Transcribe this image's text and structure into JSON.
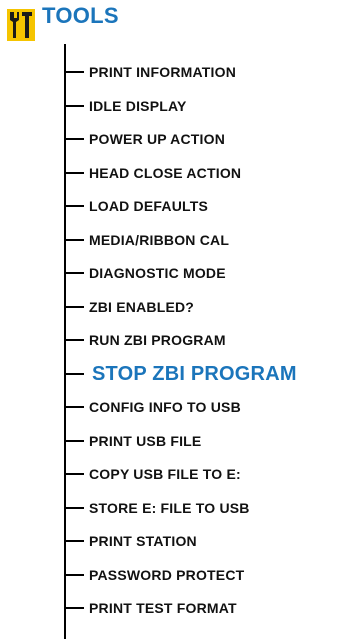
{
  "header": {
    "title": "TOOLS",
    "icon": "tools-icon",
    "colors": {
      "title": "#1b75bb",
      "icon_bg": "#f5c400",
      "icon_fg": "#1a1a1a"
    }
  },
  "menu": {
    "items": [
      {
        "label": "PRINT INFORMATION"
      },
      {
        "label": "IDLE DISPLAY"
      },
      {
        "label": "POWER UP ACTION"
      },
      {
        "label": "HEAD CLOSE ACTION"
      },
      {
        "label": "LOAD DEFAULTS"
      },
      {
        "label": "MEDIA/RIBBON CAL"
      },
      {
        "label": "DIAGNOSTIC MODE"
      },
      {
        "label": "ZBI ENABLED?"
      },
      {
        "label": "RUN ZBI PROGRAM"
      },
      {
        "label": "STOP ZBI PROGRAM",
        "highlighted": true
      },
      {
        "label": "CONFIG INFO TO USB"
      },
      {
        "label": "PRINT USB FILE"
      },
      {
        "label": "COPY USB FILE TO E:"
      },
      {
        "label": "STORE E: FILE TO USB"
      },
      {
        "label": "PRINT STATION"
      },
      {
        "label": "PASSWORD PROTECT"
      },
      {
        "label": "PRINT TEST FORMAT"
      }
    ],
    "colors": {
      "text": "#111111",
      "highlight": "#1b75bb"
    }
  }
}
